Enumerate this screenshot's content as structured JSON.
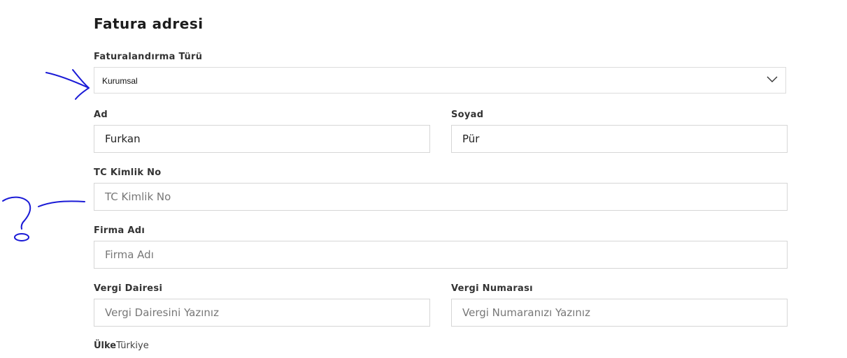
{
  "form": {
    "title": "Fatura adresi",
    "billing_type": {
      "label": "Faturalandırma Türü",
      "value": "Kurumsal"
    },
    "first_name": {
      "label": "Ad",
      "value": "Furkan"
    },
    "last_name": {
      "label": "Soyad",
      "value": "Pür"
    },
    "tc_id": {
      "label": "TC Kimlik No",
      "placeholder": "TC Kimlik No"
    },
    "company": {
      "label": "Firma Adı",
      "placeholder": "Firma Adı"
    },
    "tax_office": {
      "label": "Vergi Dairesi",
      "placeholder": "Vergi Dairesini Yazınız"
    },
    "tax_number": {
      "label": "Vergi Numarası",
      "placeholder": "Vergi Numaranızı Yazınız"
    },
    "country": {
      "label": "Ülke",
      "value": "Türkiye"
    }
  },
  "annotations": {
    "ink_color": "#1a1ad6"
  }
}
